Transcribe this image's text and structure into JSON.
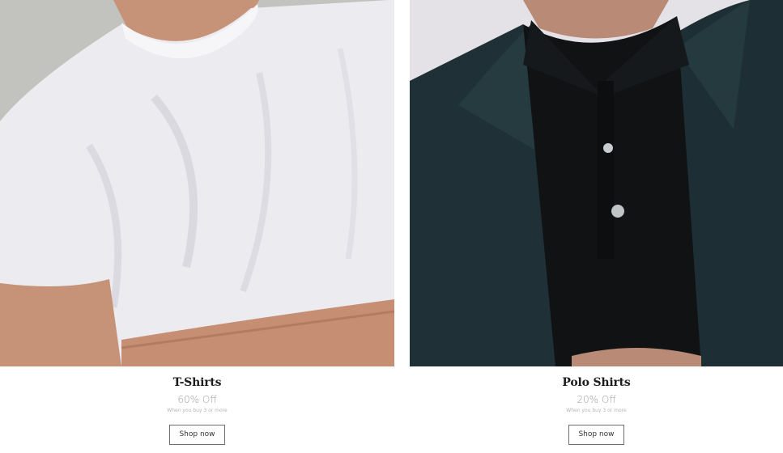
{
  "cards": [
    {
      "title": "T-Shirts",
      "offer": "60% Off",
      "subtext": "When you buy 3 or more",
      "button_label": "Shop now"
    },
    {
      "title": "Polo Shirts",
      "offer": "20% Off",
      "subtext": "When you buy 3 or more",
      "button_label": "Shop now"
    }
  ],
  "colors": {
    "background": "#ffffff",
    "tshirt": "#eeeef2",
    "polo": "#111315",
    "jacket": "#1f3136",
    "skin": "#c99479",
    "button_border": "#6e6e6e",
    "offer_text": "#9a9a9a"
  }
}
